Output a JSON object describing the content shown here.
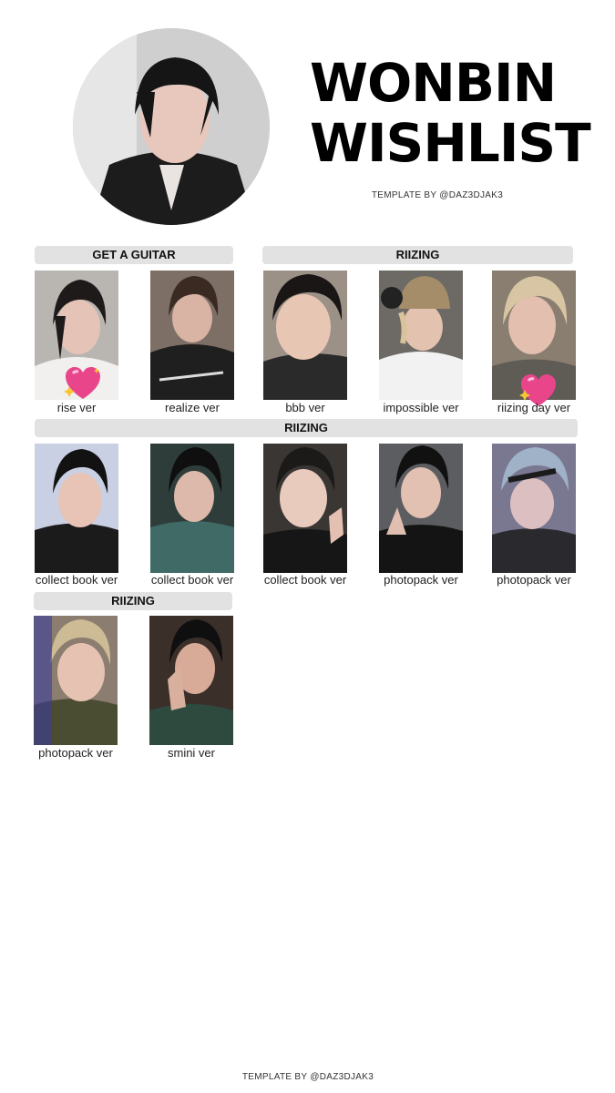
{
  "header": {
    "title_line1": "WONBIN",
    "title_line2": "WISHLIST",
    "credit": "TEMPLATE BY @DAZ3DJAK3"
  },
  "footer": {
    "credit": "TEMPLATE BY @DAZ3DJAK3"
  },
  "sections": [
    {
      "label": "GET A GUITAR"
    },
    {
      "label": "RIIZING"
    },
    {
      "label": "RIIZING"
    },
    {
      "label": "RIIZING"
    }
  ],
  "cards": [
    {
      "caption": "rise ver",
      "collected": true
    },
    {
      "caption": "realize ver",
      "collected": false
    },
    {
      "caption": "bbb ver",
      "collected": false
    },
    {
      "caption": "impossible ver",
      "collected": false
    },
    {
      "caption": "riizing day ver",
      "collected": true
    },
    {
      "caption": "collect book ver",
      "collected": false
    },
    {
      "caption": "collect book ver",
      "collected": false
    },
    {
      "caption": "collect book ver",
      "collected": false
    },
    {
      "caption": "photopack ver",
      "collected": false
    },
    {
      "caption": "photopack ver",
      "collected": false
    },
    {
      "caption": "photopack ver",
      "collected": false
    },
    {
      "caption": "smini ver",
      "collected": false
    }
  ],
  "colors": {
    "bar": "#e2e2e2",
    "heart": "#e8458b",
    "sparkle": "#f7c531"
  }
}
